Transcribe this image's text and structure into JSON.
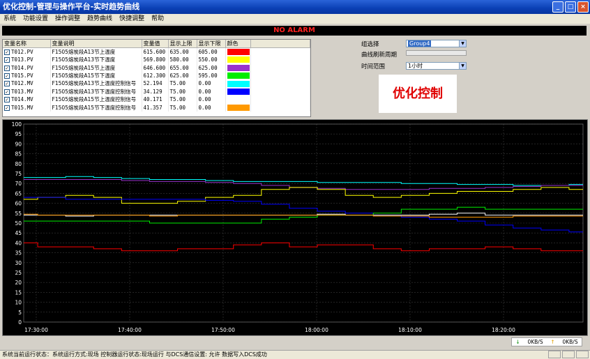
{
  "window": {
    "title": "优化控制-管理与操作平台-实时趋势曲线"
  },
  "menu": [
    "系统",
    "功能设置",
    "操作调整",
    "趋势曲线",
    "快捷调整",
    "帮助"
  ],
  "alarm": "NO ALARM",
  "table": {
    "headers": [
      "变量名称",
      "变量说明",
      "变量值",
      "显示上限",
      "显示下限",
      "颜色"
    ],
    "rows": [
      {
        "name": "T012.PV",
        "desc": "F1505熔炭段A13节上温度",
        "value": "615.600",
        "hi": "635.00",
        "lo": "605.00",
        "color": "#ff0000"
      },
      {
        "name": "T013.PV",
        "desc": "F1505熔炭段A13节下温度",
        "value": "569.800",
        "hi": "580.00",
        "lo": "550.00",
        "color": "#ffff00"
      },
      {
        "name": "T014.PV",
        "desc": "F1505熔炭段A15节上温度",
        "value": "646.600",
        "hi": "655.00",
        "lo": "625.00",
        "color": "#9933cc"
      },
      {
        "name": "T015.PV",
        "desc": "F1505熔炭段A15节下温度",
        "value": "612.300",
        "hi": "625.00",
        "lo": "595.00",
        "color": "#00ee00"
      },
      {
        "name": "T012.MV",
        "desc": "F1505熔炭段A13节上温度控制信号",
        "value": "52.194",
        "hi": "T5.00",
        "lo": "0.00",
        "color": "#00ffff"
      },
      {
        "name": "T013.MV",
        "desc": "F1505熔炭段A13节下温度控制信号",
        "value": "34.129",
        "hi": "T5.00",
        "lo": "0.00",
        "color": "#0000ff"
      },
      {
        "name": "T014.MV",
        "desc": "F1505熔炭段A15节上温度控制信号",
        "value": "40.171",
        "hi": "T5.00",
        "lo": "0.00",
        "color": "#ffffff"
      },
      {
        "name": "T015.MV",
        "desc": "F1505熔炭段A15节下温度控制信号",
        "value": "41.357",
        "hi": "T5.00",
        "lo": "0.00",
        "color": "#ff9900"
      }
    ]
  },
  "controls": {
    "group_label": "组选择",
    "group_value": "Group4",
    "refresh_label": "曲线刷新周期",
    "range_label": "时间范围",
    "range_value": "1小时"
  },
  "opt_button": "优化控制",
  "chart_data": {
    "type": "line",
    "x_ticks": [
      "17:30:00",
      "17:40:00",
      "17:50:00",
      "18:00:00",
      "18:10:00",
      "18:20:00"
    ],
    "ylim": [
      0,
      100
    ],
    "y_ticks": [
      0,
      5,
      10,
      15,
      20,
      25,
      30,
      35,
      40,
      45,
      50,
      55,
      60,
      65,
      70,
      75,
      80,
      85,
      90,
      95,
      100
    ],
    "grid": true,
    "series": [
      {
        "color": "#00ffff",
        "values": [
          73,
          73,
          73.5,
          73,
          72.5,
          72,
          72,
          71.5,
          71,
          71,
          71,
          70.5,
          70.5,
          70.5,
          70,
          70,
          69.5,
          69.5,
          69,
          69,
          69.5
        ]
      },
      {
        "color": "#9933cc",
        "values": [
          72,
          72,
          72,
          72,
          71.5,
          71,
          71,
          70.5,
          70,
          69,
          68,
          67.5,
          67,
          67,
          67,
          67.5,
          67.5,
          68,
          68.5,
          69,
          69
        ]
      },
      {
        "color": "#ffff00",
        "values": [
          62,
          63,
          64,
          63,
          60,
          60,
          61,
          63,
          64,
          67,
          68,
          67,
          64,
          63,
          64,
          65,
          66,
          66,
          67,
          68,
          67
        ]
      },
      {
        "color": "#0000ff",
        "values": [
          63,
          63,
          62,
          62,
          62,
          62,
          62,
          61.5,
          61,
          59.5,
          57.5,
          56,
          55,
          54,
          53,
          52,
          51,
          49,
          47.5,
          46.5,
          45.5
        ]
      },
      {
        "color": "#00ee00",
        "values": [
          51,
          51,
          51,
          51,
          51,
          50,
          50,
          50,
          50,
          52,
          53,
          54,
          54,
          55,
          57,
          57,
          58,
          57,
          57,
          57,
          57
        ]
      },
      {
        "color": "#ffffff",
        "values": [
          54,
          54,
          53.5,
          54,
          54,
          54,
          54,
          54,
          54,
          54,
          54,
          54.5,
          54,
          54,
          54,
          54.5,
          55,
          54,
          54,
          54,
          54
        ]
      },
      {
        "color": "#ff9900",
        "values": [
          54.5,
          54,
          54,
          54,
          54,
          53.5,
          54,
          54,
          54,
          54,
          54,
          54,
          54,
          53.5,
          53.5,
          53,
          53,
          53,
          53.5,
          53.5,
          53.5
        ]
      },
      {
        "color": "#ff0000",
        "values": [
          40,
          38,
          38,
          37,
          36,
          36,
          37,
          37,
          39,
          40,
          38,
          39,
          39,
          37,
          36,
          37,
          37,
          38,
          37,
          36,
          36
        ]
      }
    ]
  },
  "net": {
    "down": "0KB/S",
    "up": "0KB/S"
  },
  "status": "系统当前运行状态：系统运行方式:现场  控制器运行状态:现场运行  与DCS通信设置: 允许    数据写入DCS成功"
}
